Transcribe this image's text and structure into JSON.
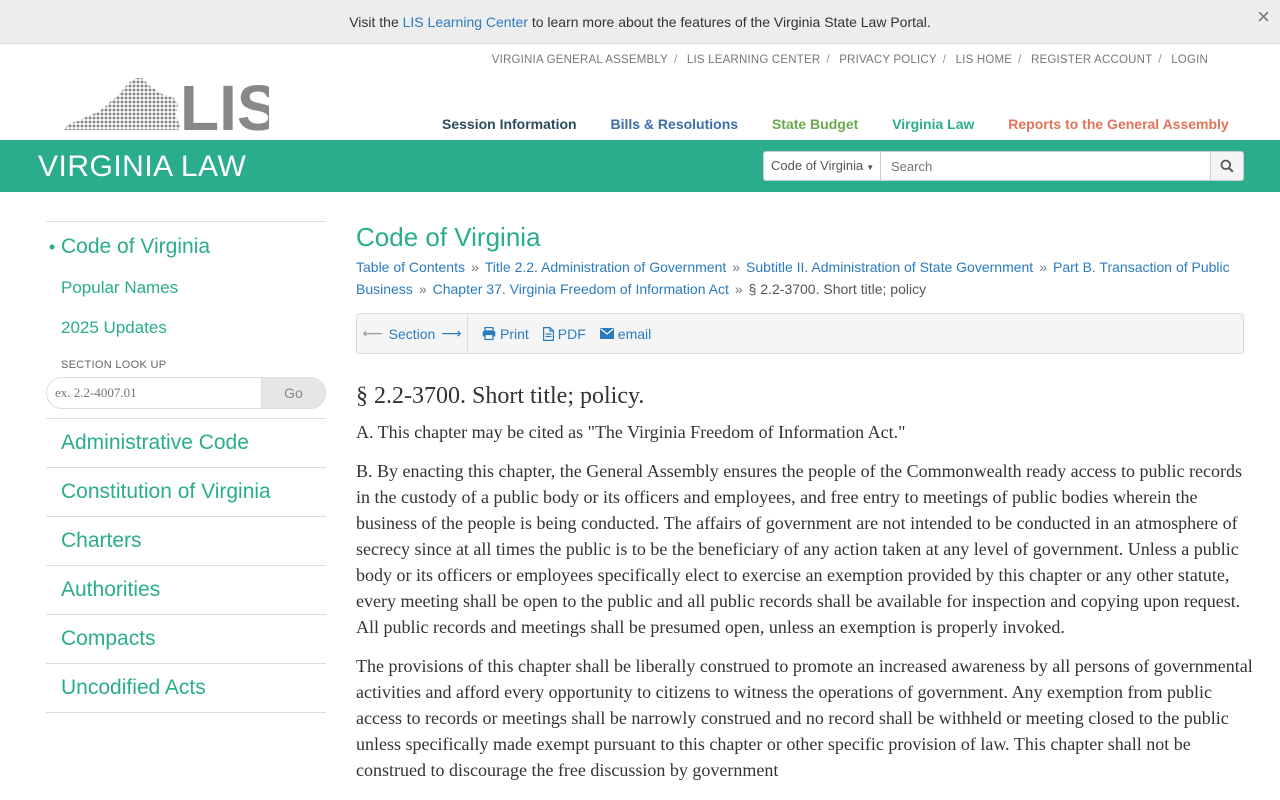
{
  "banner": {
    "prefix": "Visit the",
    "link": "LIS Learning Center",
    "suffix": "to learn more about the features of the Virginia State Law Portal.",
    "close": "×"
  },
  "utility_links": [
    "VIRGINIA GENERAL ASSEMBLY",
    "LIS LEARNING CENTER",
    "PRIVACY POLICY",
    "LIS HOME",
    "REGISTER ACCOUNT",
    "LOGIN"
  ],
  "logo": {
    "text": "LIS"
  },
  "main_nav": [
    {
      "label": "Session Information",
      "color": "#2d4b5e"
    },
    {
      "label": "Bills & Resolutions",
      "color": "#3a6ea5"
    },
    {
      "label": "State Budget",
      "color": "#6aa84f"
    },
    {
      "label": "Virginia Law",
      "color": "#2aad8c"
    },
    {
      "label": "Reports to the General Assembly",
      "color": "#e0735a"
    }
  ],
  "header": {
    "title": "VIRGINIA LAW",
    "search_scope": "Code of Virginia",
    "search_placeholder": "Search",
    "accent": "#2aad8c"
  },
  "sidebar": {
    "primary": [
      {
        "label": "Code of Virginia",
        "active": true
      },
      {
        "label": "Popular Names"
      },
      {
        "label": "2025 Updates"
      }
    ],
    "lookup_label": "SECTION LOOK UP",
    "lookup_placeholder": "ex. 2.2-4007.01",
    "lookup_button": "Go",
    "sections": [
      "Administrative Code",
      "Constitution of Virginia",
      "Charters",
      "Authorities",
      "Compacts",
      "Uncodified Acts"
    ]
  },
  "content": {
    "title": "Code of Virginia",
    "breadcrumb": [
      "Table of Contents",
      "Title 2.2. Administration of Government",
      "Subtitle II. Administration of State Government",
      "Part B. Transaction of Public Business",
      "Chapter 37. Virginia Freedom of Information Act"
    ],
    "breadcrumb_current": "§ 2.2-3700. Short title; policy",
    "toolbar": {
      "section": "Section",
      "print": "Print",
      "pdf": "PDF",
      "email": "email"
    },
    "section_title": "§ 2.2-3700. Short title; policy.",
    "paragraphs": [
      "A. This chapter may be cited as \"The Virginia Freedom of Information Act.\"",
      "B. By enacting this chapter, the General Assembly ensures the people of the Commonwealth ready access to public records in the custody of a public body or its officers and employees, and free entry to meetings of public bodies wherein the business of the people is being conducted. The affairs of government are not intended to be conducted in an atmosphere of secrecy since at all times the public is to be the beneficiary of any action taken at any level of government. Unless a public body or its officers or employees specifically elect to exercise an exemption provided by this chapter or any other statute, every meeting shall be open to the public and all public records shall be available for inspection and copying upon request. All public records and meetings shall be presumed open, unless an exemption is properly invoked.",
      "The provisions of this chapter shall be liberally construed to promote an increased awareness by all persons of governmental activities and afford every opportunity to citizens to witness the operations of government. Any exemption from public access to records or meetings shall be narrowly construed and no record shall be withheld or meeting closed to the public unless specifically made exempt pursuant to this chapter or other specific provision of law. This chapter shall not be construed to discourage the free discussion by government"
    ]
  }
}
